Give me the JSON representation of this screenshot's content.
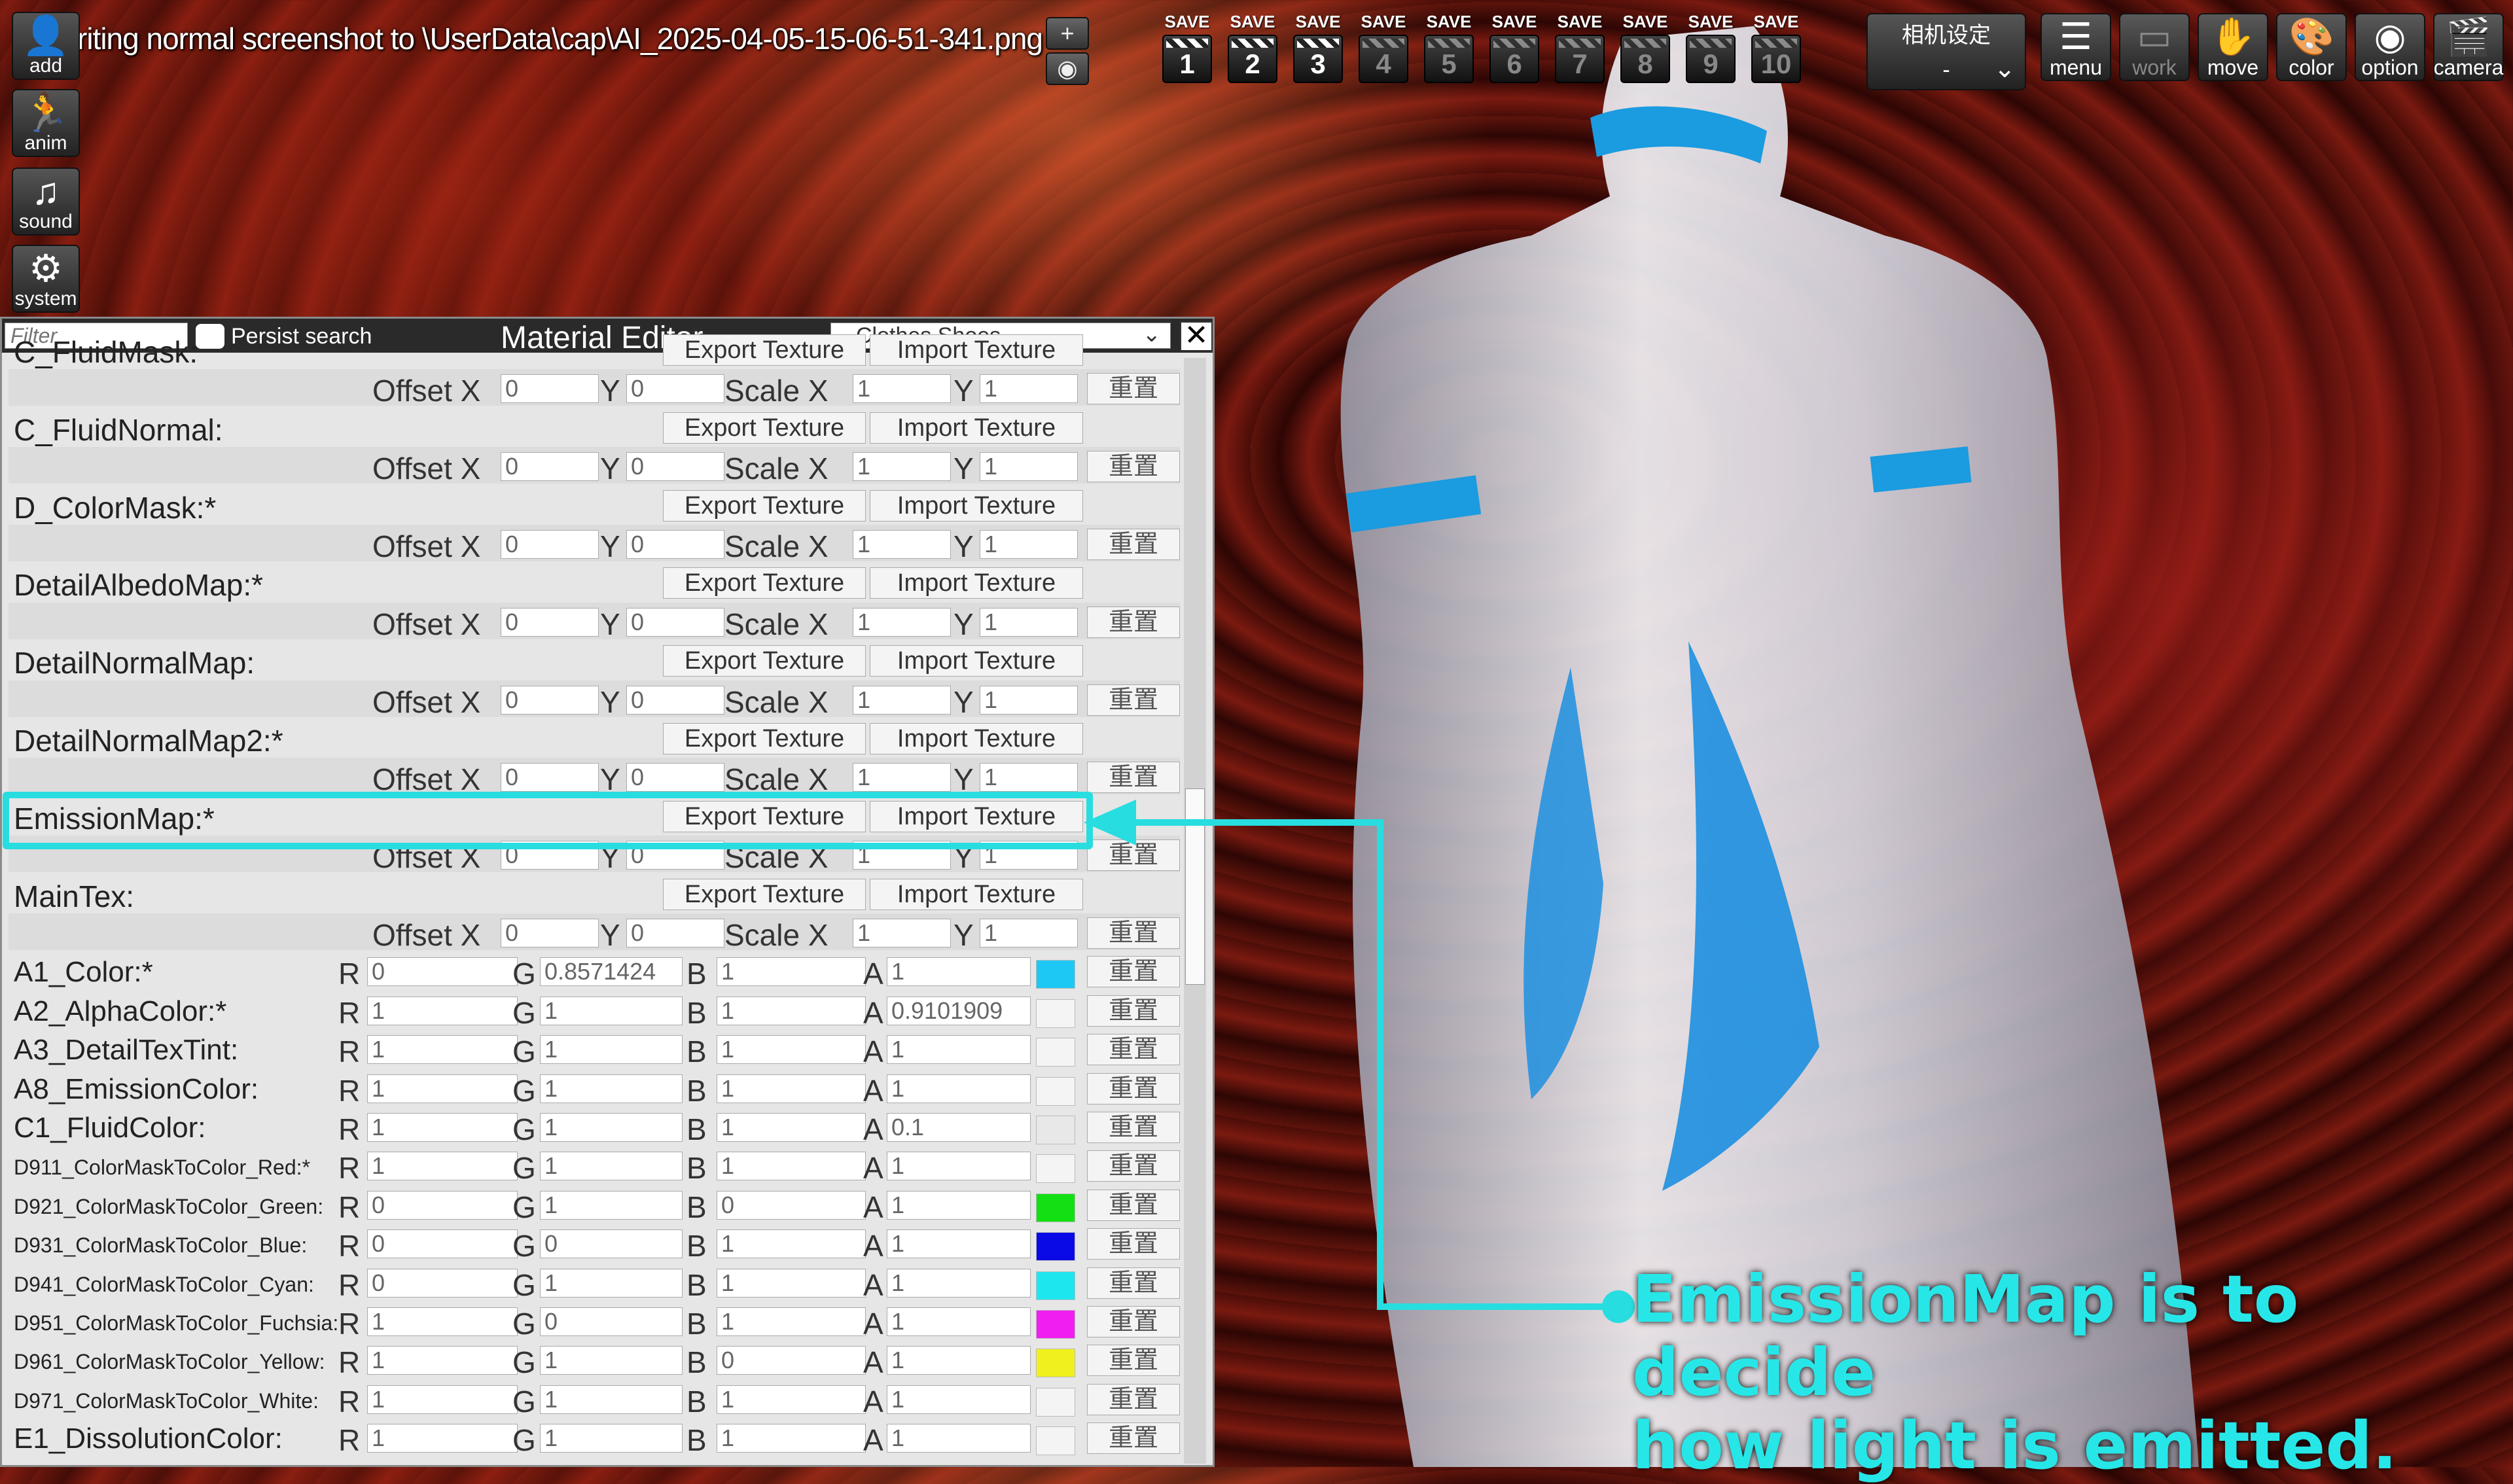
{
  "status": {
    "text": "riting normal screenshot to \\UserData\\cap\\AI_2025-04-05-15-06-51-341.png"
  },
  "sidebar": {
    "items": [
      {
        "label": "add",
        "icon": "person-add-icon"
      },
      {
        "label": "anim",
        "icon": "running-person-icon"
      },
      {
        "label": "sound",
        "icon": "music-note-icon"
      },
      {
        "label": "system",
        "icon": "gears-icon"
      }
    ]
  },
  "mini_buttons": [
    {
      "label": "+"
    },
    {
      "label": "◉"
    }
  ],
  "save_slots": {
    "save_label": "SAVE",
    "slots": [
      "1",
      "2",
      "3",
      "4",
      "5",
      "6",
      "7",
      "8",
      "9",
      "10"
    ]
  },
  "camera_setting": {
    "title": "相机设定",
    "value": "-"
  },
  "toolbar": {
    "buttons": [
      {
        "label": "menu",
        "icon": "menu-list-icon"
      },
      {
        "label": "work",
        "icon": "work-monitor-icon"
      },
      {
        "label": "move",
        "icon": "hand-icon"
      },
      {
        "label": "color",
        "icon": "palette-icon"
      },
      {
        "label": "option",
        "icon": "eye-icon"
      },
      {
        "label": "camera",
        "icon": "clapper-icon"
      }
    ]
  },
  "editor": {
    "filter_placeholder": "Filter",
    "persist_label": "Persist search",
    "title": "Material Editor",
    "selected_item": "Clothes Shoes",
    "close_label": "✕",
    "export_label": "Export Texture",
    "import_label": "Import Texture",
    "reset_label": "重置",
    "offset_x_label": "Offset X",
    "y_label": "Y",
    "scale_x_label": "Scale X",
    "textures": [
      {
        "name": "C_FluidMask:",
        "offset_x": "0",
        "offset_y": "0",
        "scale_x": "1",
        "scale_y": "1"
      },
      {
        "name": "C_FluidNormal:",
        "offset_x": "0",
        "offset_y": "0",
        "scale_x": "1",
        "scale_y": "1"
      },
      {
        "name": "D_ColorMask:*",
        "offset_x": "0",
        "offset_y": "0",
        "scale_x": "1",
        "scale_y": "1"
      },
      {
        "name": "DetailAlbedoMap:*",
        "offset_x": "0",
        "offset_y": "0",
        "scale_x": "1",
        "scale_y": "1"
      },
      {
        "name": "DetailNormalMap:",
        "offset_x": "0",
        "offset_y": "0",
        "scale_x": "1",
        "scale_y": "1"
      },
      {
        "name": "DetailNormalMap2:*",
        "offset_x": "0",
        "offset_y": "0",
        "scale_x": "1",
        "scale_y": "1"
      },
      {
        "name": "EmissionMap:*",
        "offset_x": "0",
        "offset_y": "0",
        "scale_x": "1",
        "scale_y": "1"
      },
      {
        "name": "MainTex:",
        "offset_x": "0",
        "offset_y": "0",
        "scale_x": "1",
        "scale_y": "1"
      }
    ],
    "colors": [
      {
        "name": "A1_Color:*",
        "r": "0",
        "g": "0.8571424",
        "b": "1",
        "a": "1",
        "swatch": "#1ec8f5"
      },
      {
        "name": "A2_AlphaColor:*",
        "r": "1",
        "g": "1",
        "b": "1",
        "a": "0.9101909",
        "swatch": "#f4f4f4"
      },
      {
        "name": "A3_DetailTexTint:",
        "r": "1",
        "g": "1",
        "b": "1",
        "a": "1",
        "swatch": "#f4f4f4"
      },
      {
        "name": "A8_EmissionColor:",
        "r": "1",
        "g": "1",
        "b": "1",
        "a": "1",
        "swatch": "#f4f4f4"
      },
      {
        "name": "C1_FluidColor:",
        "r": "1",
        "g": "1",
        "b": "1",
        "a": "0.1",
        "swatch": "#e8e8e8"
      },
      {
        "name": "D911_ColorMaskToColor_Red:*",
        "r": "1",
        "g": "1",
        "b": "1",
        "a": "1",
        "swatch": "#f4f4f4"
      },
      {
        "name": "D921_ColorMaskToColor_Green:",
        "r": "0",
        "g": "1",
        "b": "0",
        "a": "1",
        "swatch": "#12e012"
      },
      {
        "name": "D931_ColorMaskToColor_Blue:",
        "r": "0",
        "g": "0",
        "b": "1",
        "a": "1",
        "swatch": "#0a0ae6"
      },
      {
        "name": "D941_ColorMaskToColor_Cyan:",
        "r": "0",
        "g": "1",
        "b": "1",
        "a": "1",
        "swatch": "#1ee6ee"
      },
      {
        "name": "D951_ColorMaskToColor_Fuchsia:",
        "r": "1",
        "g": "0",
        "b": "1",
        "a": "1",
        "swatch": "#f01ef0"
      },
      {
        "name": "D961_ColorMaskToColor_Yellow:",
        "r": "1",
        "g": "1",
        "b": "0",
        "a": "1",
        "swatch": "#f0f01e"
      },
      {
        "name": "D971_ColorMaskToColor_White:",
        "r": "1",
        "g": "1",
        "b": "1",
        "a": "1",
        "swatch": "#f4f4f4"
      },
      {
        "name": "E1_DissolutionColor:",
        "r": "1",
        "g": "1",
        "b": "1",
        "a": "1",
        "swatch": "#f4f4f4"
      }
    ]
  },
  "annotation": {
    "lines": [
      "EmissionMap is to decide",
      "how light is emitted."
    ],
    "color": "#27dde0"
  }
}
